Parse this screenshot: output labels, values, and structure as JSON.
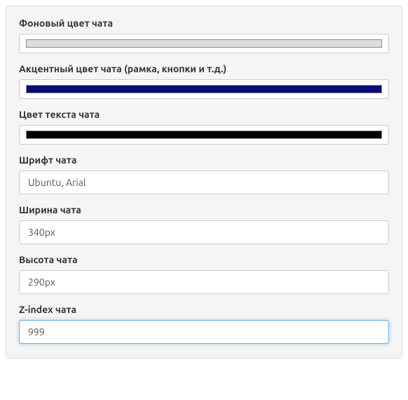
{
  "fields": {
    "bg_color": {
      "label": "Фоновый цвет чата",
      "value": "#dddddd"
    },
    "accent_color": {
      "label": "Акцентный цвет чата (рамка, кнопки и т.д.)",
      "value": "#0a0a7a"
    },
    "text_color": {
      "label": "Цвет текста чата",
      "value": "#000000"
    },
    "font": {
      "label": "Шрифт чата",
      "value": "Ubuntu, Arial"
    },
    "width": {
      "label": "Ширина чата",
      "value": "340px"
    },
    "height": {
      "label": "Высота чата",
      "value": "290px"
    },
    "zindex": {
      "label": "Z-index чата",
      "value": "999"
    }
  }
}
